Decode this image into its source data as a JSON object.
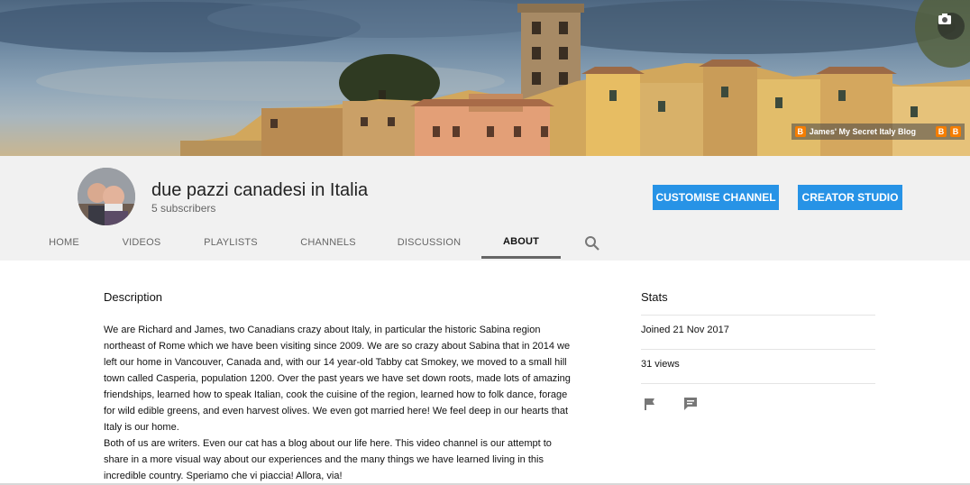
{
  "banner": {
    "camera_icon": "camera-icon",
    "links": [
      {
        "label": "James' My Secret Italy Blog",
        "icon": "blogger-icon"
      },
      {
        "label": "",
        "icon": "blogger-icon"
      },
      {
        "label": "",
        "icon": "blogger-icon"
      }
    ],
    "blogger_glyph": "B"
  },
  "channel": {
    "title": "due pazzi canadesi in Italia",
    "subscribers": "5 subscribers"
  },
  "buttons": {
    "customise": "CUSTOMISE CHANNEL",
    "creator_studio": "CREATOR STUDIO"
  },
  "tabs": [
    "HOME",
    "VIDEOS",
    "PLAYLISTS",
    "CHANNELS",
    "DISCUSSION",
    "ABOUT"
  ],
  "active_tab": "ABOUT",
  "about": {
    "description_title": "Description",
    "paragraphs": [
      "We are Richard and James, two Canadians crazy about Italy, in particular the historic Sabina region northeast of Rome which we have been visiting since 2009. We are so crazy about Sabina that in 2014 we left our home in Vancouver, Canada and, with our 14 year-old Tabby cat Smokey, we moved to a small hill town called Casperia, population 1200. Over the past years we have set down roots, made lots of amazing friendships, learned how to speak Italian, cook the cuisine of the region, learned how to folk dance, forage for wild edible greens, and even harvest olives. We even got married here! We feel deep in our hearts that Italy is our home.",
      "Both of us are writers. Even our cat has a blog about our life here. This video channel is our attempt to share in a more visual way about our experiences and the many things we have learned living in this incredible country. Speriamo che vi piaccia! Allora, via!"
    ],
    "stats_title": "Stats",
    "joined": "Joined 21 Nov 2017",
    "views": "31 views"
  },
  "colors": {
    "accent": "#2793e6",
    "header_bg": "#f1f1f1",
    "blogger": "#f57d00"
  }
}
